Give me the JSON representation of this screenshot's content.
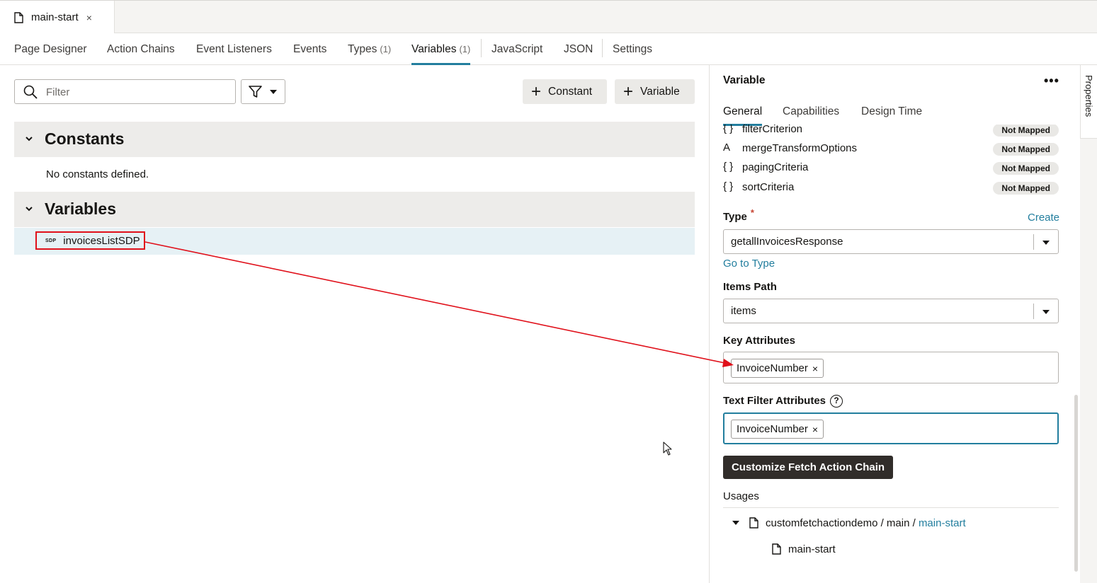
{
  "file_tab": {
    "label": "main-start",
    "close": "×"
  },
  "editor_tabs": [
    {
      "label": "Page Designer",
      "count": ""
    },
    {
      "label": "Action Chains",
      "count": ""
    },
    {
      "label": "Event Listeners",
      "count": ""
    },
    {
      "label": "Events",
      "count": ""
    },
    {
      "label": "Types",
      "count": "(1)"
    },
    {
      "label": "Variables",
      "count": "(1)"
    },
    {
      "label": "JavaScript",
      "count": ""
    },
    {
      "label": "JSON",
      "count": ""
    },
    {
      "label": "Settings",
      "count": ""
    }
  ],
  "active_tab": "Variables",
  "toolbar": {
    "filter_placeholder": "Filter",
    "constant_button": "Constant",
    "variable_button": "Variable"
  },
  "constants": {
    "title": "Constants",
    "empty": "No constants defined."
  },
  "variables": {
    "title": "Variables",
    "items": [
      {
        "badge": "SDP",
        "name": "invoicesListSDP"
      }
    ]
  },
  "properties": {
    "title": "Variable",
    "more": "•••",
    "side_label": "Properties",
    "tabs": [
      "General",
      "Capabilities",
      "Design Time"
    ],
    "mappings": [
      {
        "icon": "{ }",
        "name": "filterCriterion",
        "status": "Not Mapped"
      },
      {
        "icon": "A",
        "name": "mergeTransformOptions",
        "status": "Not Mapped"
      },
      {
        "icon": "{ }",
        "name": "pagingCriteria",
        "status": "Not Mapped"
      },
      {
        "icon": "{ }",
        "name": "sortCriteria",
        "status": "Not Mapped"
      }
    ],
    "type_label": "Type",
    "required_mark": "*",
    "create_link": "Create",
    "type_value": "getallInvoicesResponse",
    "go_to_type": "Go to Type",
    "items_path_label": "Items Path",
    "items_path_value": "items",
    "key_attributes_label": "Key Attributes",
    "key_attributes_chip": "InvoiceNumber",
    "text_filter_label": "Text Filter Attributes",
    "help_glyph": "?",
    "text_filter_chip": "InvoiceNumber",
    "chip_remove": "×",
    "customize_button": "Customize Fetch Action Chain",
    "usages_label": "Usages",
    "usage_path_prefix": "customfetchactiondemo / main / ",
    "usage_path_link": "main-start",
    "usage_child": "main-start"
  },
  "colors": {
    "accent": "#227e9e",
    "annotation": "#e0101a",
    "dark_button": "#312d2a"
  }
}
